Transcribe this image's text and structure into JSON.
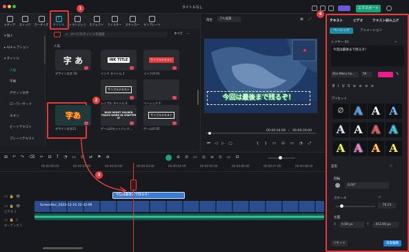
{
  "window": {
    "title": "タイトルなし",
    "export_label": "エクスポート"
  },
  "toolbar": {
    "items": [
      {
        "label": "メディア",
        "icon": "media-icon"
      },
      {
        "label": "ストック",
        "icon": "stock-icon"
      },
      {
        "label": "オーディオ",
        "icon": "audio-icon"
      },
      {
        "label": "タイトル",
        "icon": "title-T-icon"
      },
      {
        "label": "トランジション",
        "icon": "transition-icon"
      },
      {
        "label": "エフェクト",
        "icon": "effect-icon"
      },
      {
        "label": "フィルター",
        "icon": "filter-icon"
      },
      {
        "label": "ステッカー",
        "icon": "sticker-icon"
      },
      {
        "label": "テンプレート",
        "icon": "template-icon"
      }
    ]
  },
  "sidebar": {
    "items": [
      {
        "label": "▾ 個人"
      },
      {
        "label": "▸ AIキャプション"
      },
      {
        "label": "▾ タイトル"
      },
      {
        "label": "人気"
      },
      {
        "label": "字幕"
      },
      {
        "label": "デザイン文字"
      },
      {
        "label": "ローワーサード"
      },
      {
        "label": "ネオン"
      },
      {
        "label": "ビートテキスト"
      },
      {
        "label": "プレーンテキスト"
      }
    ]
  },
  "library": {
    "search_placeholder": "すべてのタイトルを検索",
    "filter_label": "すべて",
    "section_label": "人気",
    "cards": [
      {
        "label": "デザイン文字 30",
        "glyph": "字 あ"
      },
      {
        "label": "インク タイトル 1",
        "glyph": "INK TITLE"
      },
      {
        "label": "インクUI 01",
        "glyph": "サンプルテキスト"
      },
      {
        "label": "デザイン文字21",
        "glyph": "字あ"
      },
      {
        "label": "シンプル タイトル 4",
        "glyph": "サンプルテキスト"
      },
      {
        "label": "ベーシック 4",
        "glyph": ""
      },
      {
        "label": "ゲームUIセットパック…",
        "glyph": "BOSS MIGHT GOLDEN TOUCH WORK IN CHAPTER 5?"
      },
      {
        "label": "ゲームUI 02",
        "glyph": "サンプルテキスト"
      }
    ]
  },
  "player": {
    "label": "再生",
    "quality": "フル品質",
    "current_time": "00:00:04:06",
    "total_time": "00:09:39:00",
    "caption": "今回は最後まで残るぞ！"
  },
  "properties": {
    "tabs": [
      "テキスト",
      "ビデオ",
      "テキスト読み上げ"
    ],
    "subtabs": [
      "ベーシック",
      "アニメーション"
    ],
    "layer_label": "レイヤー 01",
    "text_value": "今回は最後まで残るぞ！",
    "font": "Zen Maru Go...",
    "font_size": "56",
    "text_color": "#e91e8c",
    "preset_label": "プリセット",
    "transform_label": "変形",
    "rotate_label": "回転",
    "rotate_value": "0.00°",
    "scale_label": "スケール",
    "scale_value": "76.15",
    "position_label": "位置",
    "pos_x_label": "X",
    "pos_x": "0.00",
    "pos_x_unit": "px",
    "pos_y_label": "Y",
    "pos_y": "-413.00",
    "pos_y_unit": "px",
    "reset_label": "リセット",
    "advanced_label": "高度編集"
  },
  "timeline": {
    "ruler": [
      "00:00:00:00",
      "00:00:01:00",
      "00:00:02:00",
      "00:00:03:00",
      "00:00:04:00",
      "00:00:05:00",
      "00:00:06:00",
      "00:00:07:00",
      "00:00:08:00"
    ],
    "title_clip": "今回は最後まで残るぞ！",
    "video_clip": "ScreenRec_2024-12-16 22-33-09",
    "track_labels": {
      "video": "ビデオ 1",
      "audio": "オーディオ 1"
    }
  },
  "annotations": {
    "badges": [
      "1",
      "2",
      "3",
      "4"
    ],
    "accent": "#e23c3c"
  }
}
